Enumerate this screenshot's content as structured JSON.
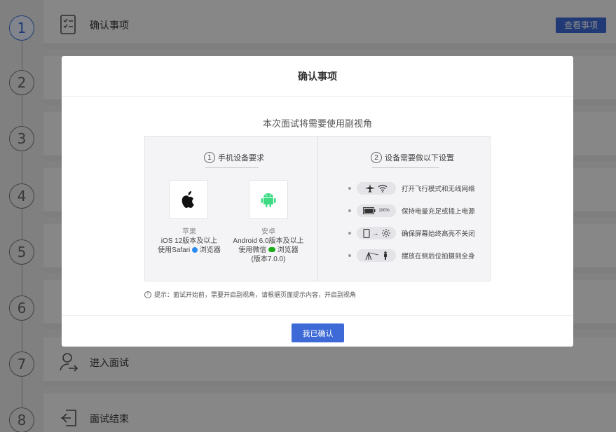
{
  "steps": [
    "1",
    "2",
    "3",
    "4",
    "5",
    "6",
    "7",
    "8"
  ],
  "rows": {
    "confirm": {
      "label": "确认事项",
      "button": "查看事项"
    },
    "enter": {
      "label": "进入面试"
    },
    "end": {
      "label": "面试结束"
    }
  },
  "modal": {
    "title": "确认事项",
    "subtitle": "本次面试将需要使用副视角",
    "col1": {
      "num": "1",
      "title": "手机设备要求",
      "apple": {
        "name": "苹果",
        "line1": "iOS 12版本及以上",
        "line2_prefix": "使用Safari",
        "line2_suffix": "浏览器"
      },
      "android": {
        "name": "安卓",
        "line1": "Android 6.0版本及以上",
        "line2_prefix": "使用微信",
        "line2_suffix": "浏览器",
        "line3": "(版本7.0.0)"
      }
    },
    "col2": {
      "num": "2",
      "title": "设备需要做以下设置",
      "items": [
        {
          "text": "打开飞行模式和无线网络",
          "icons": [
            "airplane-icon",
            "wifi-icon"
          ]
        },
        {
          "text": "保持电量充足或插上电源",
          "badge": "100%",
          "icons": [
            "battery-icon"
          ]
        },
        {
          "text": "确保屏幕始终高亮不关闭",
          "icons": [
            "phone-icon",
            "sun-icon"
          ]
        },
        {
          "text": "摆放在侧后位拍摄到全身",
          "icons": [
            "tripod-icon",
            "person-icon"
          ]
        }
      ]
    },
    "tip_icon": "!",
    "tip": "提示：面试开始前，需要开启副视角，请根据页面提示内容，开启副视角",
    "confirm_button": "我已确认"
  },
  "colors": {
    "accent": "#3d6ad6",
    "safari": "#2a8cf0",
    "wechat": "#1aad19",
    "android": "#3ddc84"
  }
}
